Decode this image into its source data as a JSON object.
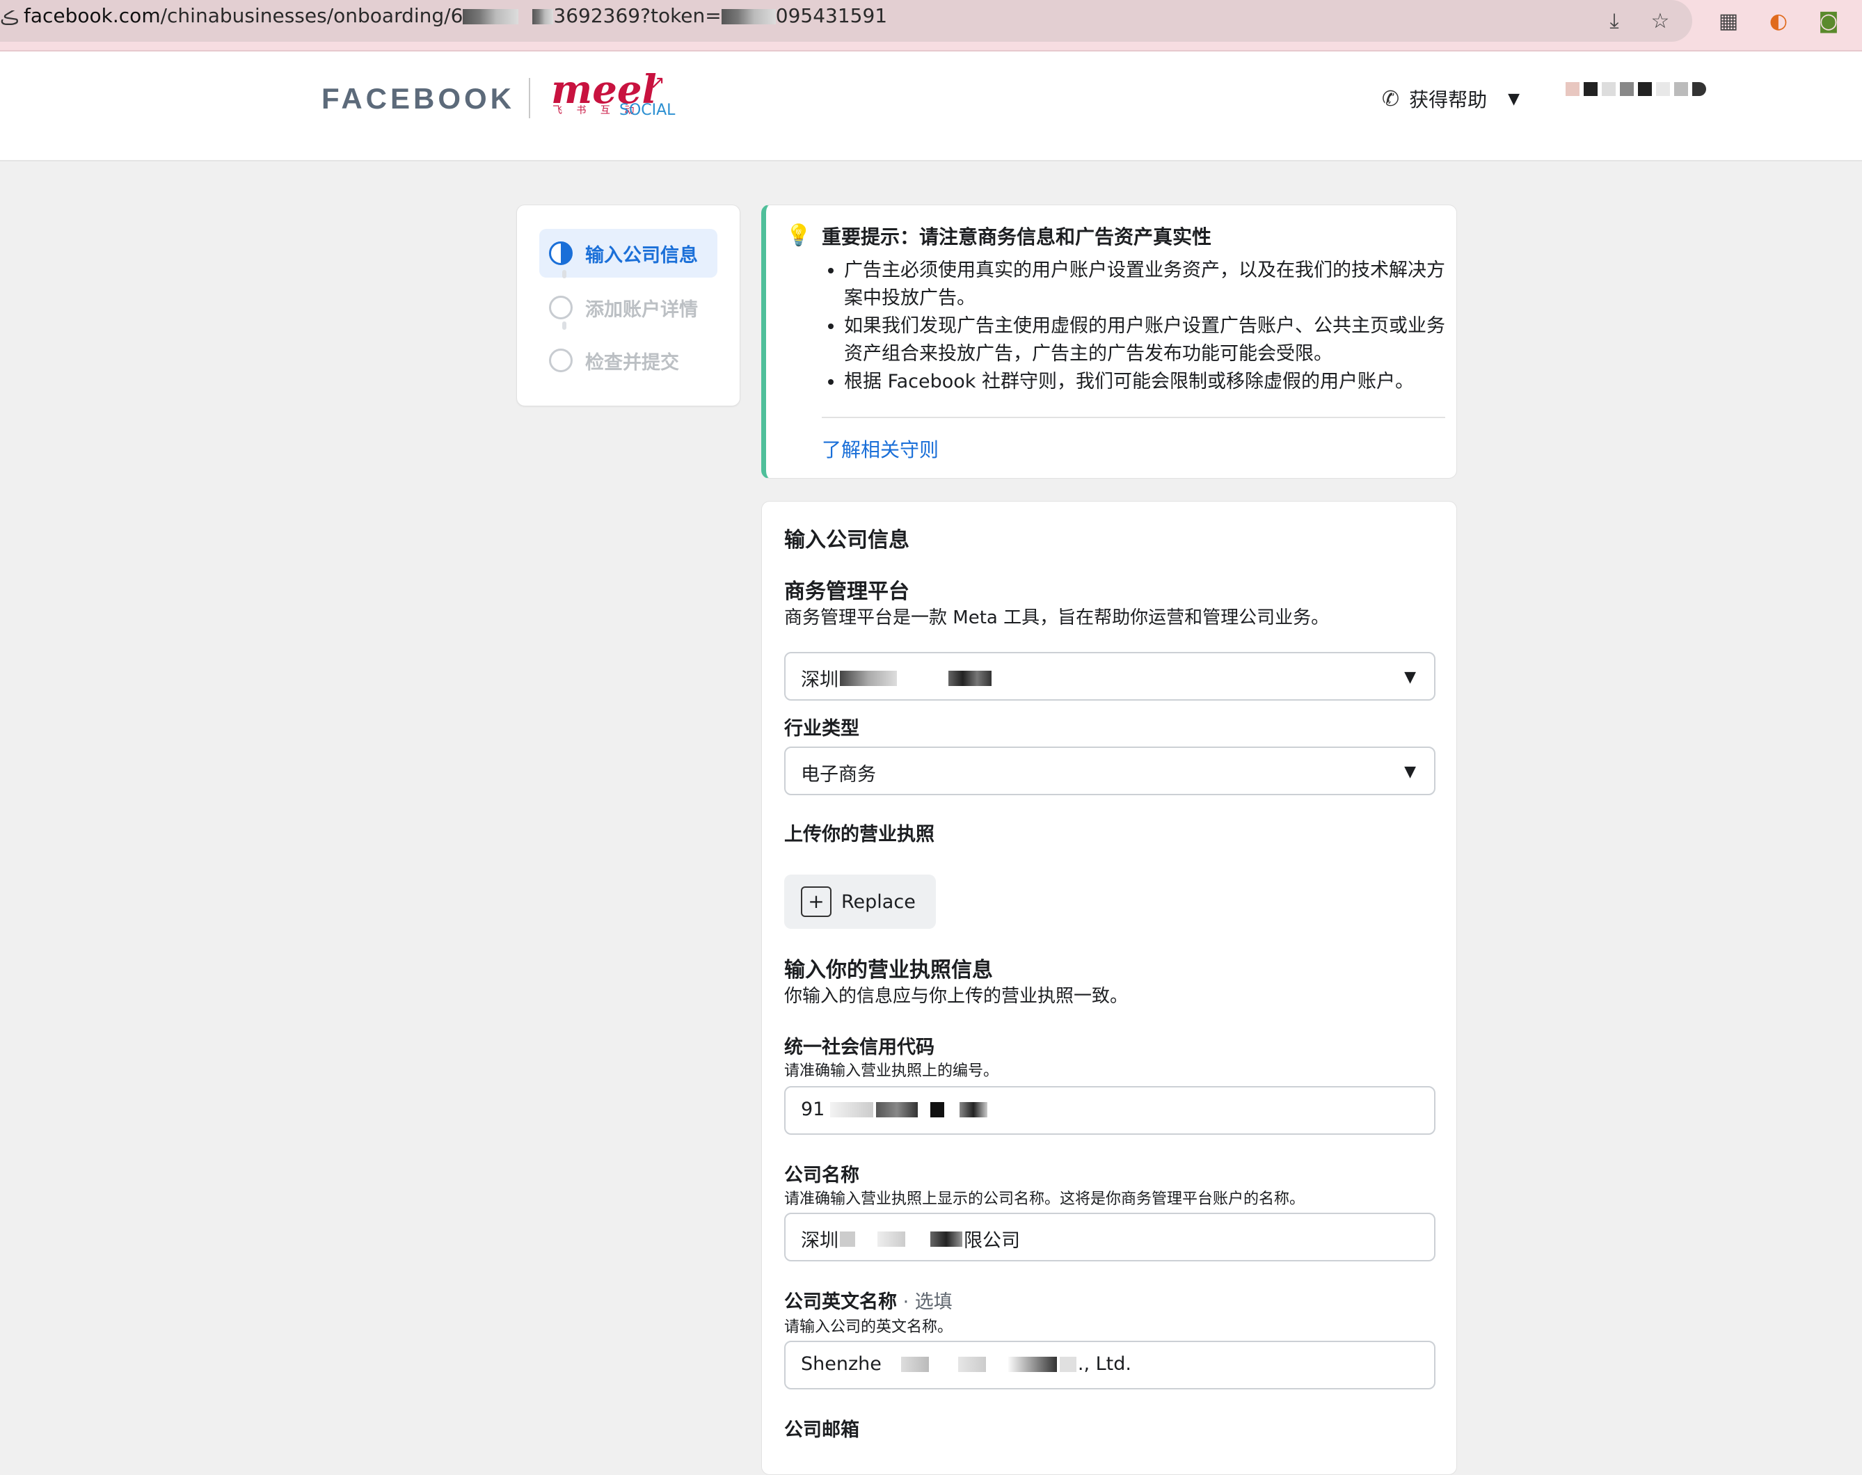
{
  "browser": {
    "url_prefix": "facebook.com",
    "url_path_start": "/chinabusinesses/onboarding/6",
    "url_path_mid": "3692369?token=",
    "url_path_end": "095431591",
    "icons": [
      "install-icon",
      "star-icon",
      "qr-icon",
      "extension-icon",
      "glasses-icon"
    ]
  },
  "header": {
    "facebook_logo": "FACEBOOK",
    "partner_logo": "meel",
    "partner_logo_sub": "飞 书 互 动",
    "partner_logo_social": "SOCIAL",
    "help_label": "获得帮助"
  },
  "stepper": {
    "steps": [
      {
        "label": "输入公司信息",
        "state": "active"
      },
      {
        "label": "添加账户详情",
        "state": "pending"
      },
      {
        "label": "检查并提交",
        "state": "pending"
      }
    ]
  },
  "notice": {
    "title": "重要提示：请注意商务信息和广告资产真实性",
    "items": [
      "广告主必须使用真实的用户账户设置业务资产，以及在我们的技术解决方案中投放广告。",
      "如果我们发现广告主使用虚假的用户账户设置广告账户、公共主页或业务资产组合来投放广告，广告主的广告发布功能可能会受限。",
      "根据 Facebook 社群守则，我们可能会限制或移除虚假的用户账户。"
    ],
    "link": "了解相关守则"
  },
  "form": {
    "section_title": "输入公司信息",
    "bm_title": "商务管理平台",
    "bm_desc": "商务管理平台是一款 Meta 工具，旨在帮助你运营和管理公司业务。",
    "bm_value_prefix": "深圳",
    "industry_label": "行业类型",
    "industry_value": "电子商务",
    "upload_label": "上传你的营业执照",
    "replace_button": "Replace",
    "license_title": "输入你的营业执照信息",
    "license_desc": "你输入的信息应与你上传的营业执照一致。",
    "credit_code_label": "统一社会信用代码",
    "credit_code_hint": "请准确输入营业执照上的编号。",
    "credit_code_prefix": "91",
    "company_name_label": "公司名称",
    "company_name_hint": "请准确输入营业执照上显示的公司名称。这将是你商务管理平台账户的名称。",
    "company_name_prefix": "深圳",
    "company_name_suffix": "限公司",
    "english_name_label": "公司英文名称",
    "english_name_optional": " · 选填",
    "english_name_hint": "请输入公司的英文名称。",
    "english_name_prefix": "Shenzhe",
    "english_name_suffix": "., Ltd.",
    "email_label": "公司邮箱"
  },
  "colors": {
    "accent": "#1a6fd8",
    "notice_bar": "#4fbf9a",
    "brand_red": "#c8123f"
  }
}
